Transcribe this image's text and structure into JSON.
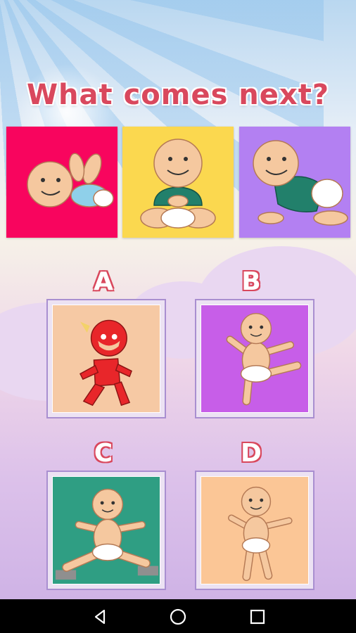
{
  "game": {
    "title": "What comes next?",
    "sequence": [
      {
        "name": "baby lying on back",
        "bg": "#f8055e"
      },
      {
        "name": "baby sitting",
        "bg": "#fbd84f"
      },
      {
        "name": "baby crawling",
        "bg": "#b380f2"
      }
    ],
    "options": [
      {
        "letter": "A",
        "bg": "#f6c9a4"
      },
      {
        "letter": "B",
        "bg": "#c75ee8"
      },
      {
        "letter": "C",
        "bg": "#2f9e83"
      },
      {
        "letter": "D",
        "bg": "#fbc696"
      }
    ]
  },
  "navbar": {
    "back_icon": "back-icon",
    "home_icon": "home-icon",
    "recents_icon": "recents-icon"
  },
  "colors": {
    "title": "#d9485d",
    "skin": "#f5c89f",
    "skin_outline": "#b57a55",
    "diaper": "#ffffff",
    "shirt_green": "#22806b",
    "shirt_blue": "#8fd0ea",
    "hero_red": "#e8262a"
  }
}
